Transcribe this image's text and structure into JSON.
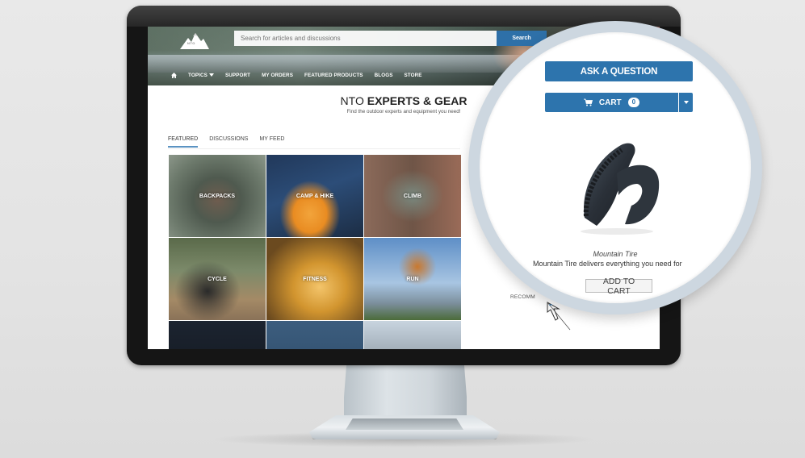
{
  "site": {
    "logo_text": "NTO",
    "search": {
      "placeholder": "Search for articles and discussions",
      "button_label": "Search"
    },
    "nav": [
      {
        "label": "",
        "icon": "home-icon"
      },
      {
        "label": "Topics",
        "icon": "chevron-down-icon"
      },
      {
        "label": "Support"
      },
      {
        "label": "My Orders"
      },
      {
        "label": "Featured Products"
      },
      {
        "label": "Blogs"
      },
      {
        "label": "Store"
      }
    ]
  },
  "page": {
    "title_prefix": "NTO",
    "title_main": "EXPERTS & GEAR",
    "subtitle": "Find the outdoor experts and equipment you need!",
    "tabs": [
      {
        "label": "Featured",
        "active": true
      },
      {
        "label": "Discussions",
        "active": false
      },
      {
        "label": "My Feed",
        "active": false
      }
    ],
    "topics": [
      {
        "label": "Backpacks"
      },
      {
        "label": "Camp & Hike"
      },
      {
        "label": "Climb"
      },
      {
        "label": "Cycle"
      },
      {
        "label": "Fitness"
      },
      {
        "label": "Run"
      },
      {
        "label": ""
      },
      {
        "label": ""
      },
      {
        "label": ""
      }
    ],
    "recommend_label": "RECOMM"
  },
  "sidebar": {
    "ask_button": "ASK A QUESTION",
    "cart": {
      "label": "CART",
      "count": "0"
    },
    "product": {
      "name": "Mountain Tire",
      "description": "Mountain Tire delivers everything you need for",
      "add_to_cart": "ADD TO CART"
    }
  },
  "colors": {
    "primary_blue": "#2d74ad",
    "magnifier_ring": "#cdd7e0",
    "tab_underline": "#5b93c2"
  }
}
